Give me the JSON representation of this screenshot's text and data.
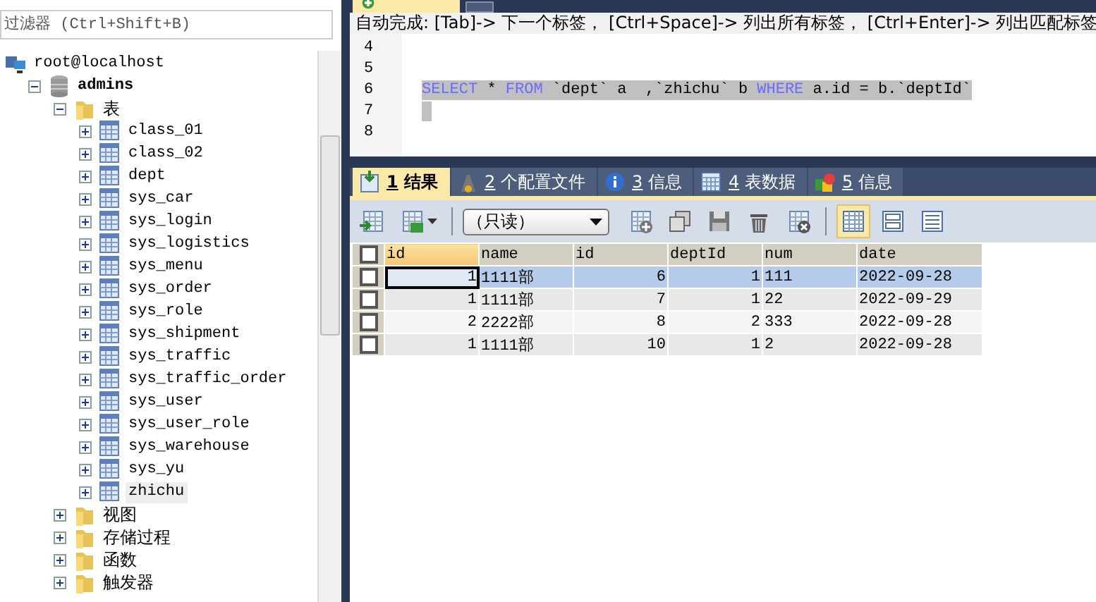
{
  "sidebar": {
    "filter": {
      "placeholder": "过滤器 (Ctrl+Shift+B)"
    },
    "tree": [
      {
        "label": "root@localhost",
        "kind": "server",
        "children": [
          {
            "label": "admins",
            "kind": "database",
            "expanded": true,
            "children": [
              {
                "label": "表",
                "kind": "folder",
                "expanded": true,
                "children": [
                  {
                    "label": "class_01",
                    "kind": "table",
                    "expanded": false,
                    "selected": false
                  },
                  {
                    "label": "class_02",
                    "kind": "table",
                    "expanded": false,
                    "selected": false
                  },
                  {
                    "label": "dept",
                    "kind": "table",
                    "expanded": false,
                    "selected": false
                  },
                  {
                    "label": "sys_car",
                    "kind": "table",
                    "expanded": false,
                    "selected": false
                  },
                  {
                    "label": "sys_login",
                    "kind": "table",
                    "expanded": false,
                    "selected": false
                  },
                  {
                    "label": "sys_logistics",
                    "kind": "table",
                    "expanded": false,
                    "selected": false
                  },
                  {
                    "label": "sys_menu",
                    "kind": "table",
                    "expanded": false,
                    "selected": false
                  },
                  {
                    "label": "sys_order",
                    "kind": "table",
                    "expanded": false,
                    "selected": false
                  },
                  {
                    "label": "sys_role",
                    "kind": "table",
                    "expanded": false,
                    "selected": false
                  },
                  {
                    "label": "sys_shipment",
                    "kind": "table",
                    "expanded": false,
                    "selected": false
                  },
                  {
                    "label": "sys_traffic",
                    "kind": "table",
                    "expanded": false,
                    "selected": false
                  },
                  {
                    "label": "sys_traffic_order",
                    "kind": "table",
                    "expanded": false,
                    "selected": false
                  },
                  {
                    "label": "sys_user",
                    "kind": "table",
                    "expanded": false,
                    "selected": false
                  },
                  {
                    "label": "sys_user_role",
                    "kind": "table",
                    "expanded": false,
                    "selected": false
                  },
                  {
                    "label": "sys_warehouse",
                    "kind": "table",
                    "expanded": false,
                    "selected": false
                  },
                  {
                    "label": "sys_yu",
                    "kind": "table",
                    "expanded": false,
                    "selected": false
                  },
                  {
                    "label": "zhichu",
                    "kind": "table",
                    "expanded": false,
                    "selected": true
                  }
                ]
              },
              {
                "label": "视图",
                "kind": "folder",
                "expanded": false
              },
              {
                "label": "存储过程",
                "kind": "folder",
                "expanded": false
              },
              {
                "label": "函数",
                "kind": "folder",
                "expanded": false
              },
              {
                "label": "触发器",
                "kind": "folder",
                "expanded": false
              }
            ]
          }
        ]
      }
    ]
  },
  "editor": {
    "hint": "自动完成: [Tab]-> 下一个标签， [Ctrl+Space]-> 列出所有标签， [Ctrl+Enter]-> 列出匹配标签",
    "lines": [
      {
        "number": "4"
      },
      {
        "number": "5"
      },
      {
        "number": "6",
        "code": "SELECT * FROM `dept` a  ,`zhichu` b WHERE a.id = b.`deptId`",
        "selected": true
      },
      {
        "number": "7",
        "selected": true
      },
      {
        "number": "8"
      }
    ]
  },
  "result_tabs": [
    {
      "number": "1",
      "label": "结果",
      "kind": "result",
      "selected": true
    },
    {
      "number": "2",
      "label": "个配置文件",
      "kind": "profile",
      "selected": false
    },
    {
      "number": "3",
      "label": "信息",
      "kind": "info",
      "selected": false
    },
    {
      "number": "4",
      "label": "表数据",
      "kind": "tabledata",
      "selected": false
    },
    {
      "number": "5",
      "label": "信息",
      "kind": "info2",
      "selected": false
    }
  ],
  "toolbar": {
    "mode": "（只读）"
  },
  "table": {
    "all_checked": false,
    "columns": [
      {
        "label": "id",
        "kind": "number",
        "selected": true
      },
      {
        "label": "name",
        "kind": "text",
        "selected": false
      },
      {
        "label": "id",
        "kind": "number",
        "selected": false
      },
      {
        "label": "deptId",
        "kind": "number",
        "selected": false
      },
      {
        "label": "num",
        "kind": "text",
        "selected": false
      },
      {
        "label": "date",
        "kind": "text",
        "selected": false
      }
    ],
    "rows": [
      {
        "selected": true,
        "checked": false,
        "cells": [
          "1",
          "1111部",
          "6",
          "1",
          "111",
          "2022-09-28"
        ]
      },
      {
        "selected": false,
        "checked": false,
        "cells": [
          "1",
          "1111部",
          "7",
          "1",
          "22",
          "2022-09-29"
        ]
      },
      {
        "selected": false,
        "checked": false,
        "cells": [
          "2",
          "2222部",
          "8",
          "2",
          "333",
          "2022-09-28"
        ]
      },
      {
        "selected": false,
        "checked": false,
        "cells": [
          "1",
          "1111部",
          "10",
          "1",
          "2",
          "2022-09-28"
        ]
      }
    ]
  }
}
